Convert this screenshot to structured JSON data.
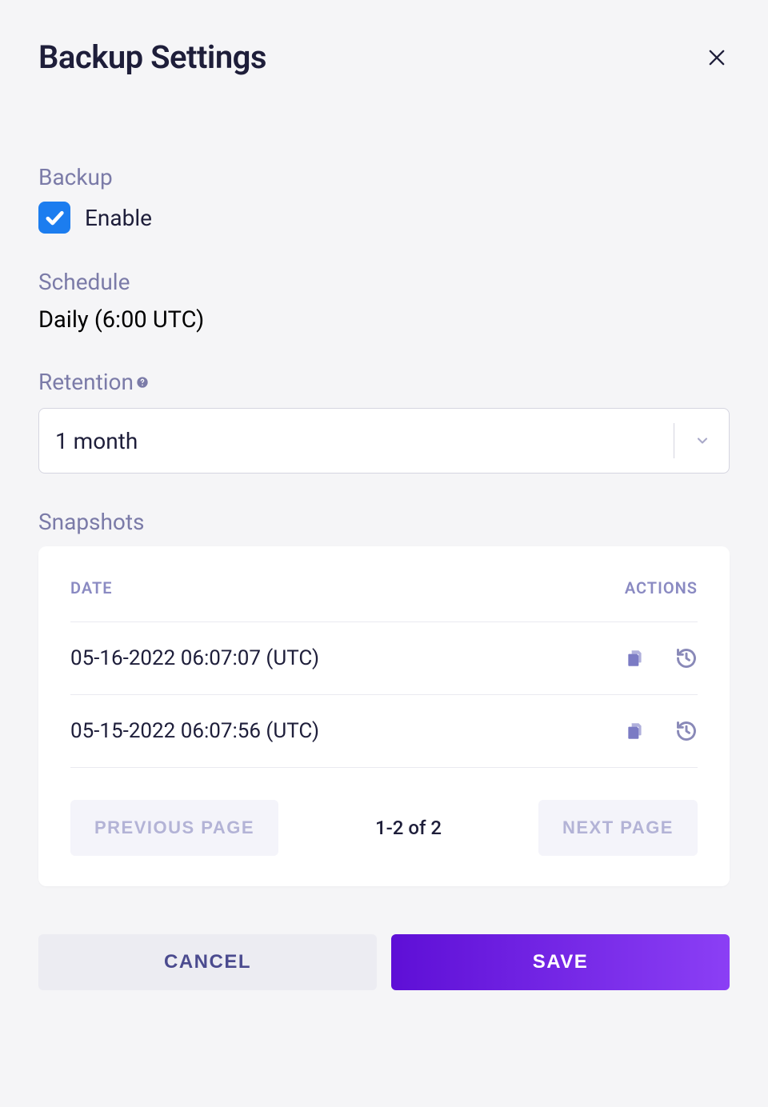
{
  "header": {
    "title": "Backup Settings"
  },
  "backup": {
    "label": "Backup",
    "enable_label": "Enable",
    "enabled": true
  },
  "schedule": {
    "label": "Schedule",
    "value": "Daily (6:00 UTC)"
  },
  "retention": {
    "label": "Retention",
    "value": "1 month"
  },
  "snapshots": {
    "label": "Snapshots",
    "columns": {
      "date": "DATE",
      "actions": "ACTIONS"
    },
    "rows": [
      {
        "date": "05-16-2022 06:07:07 (UTC)"
      },
      {
        "date": "05-15-2022 06:07:56 (UTC)"
      }
    ],
    "pagination": {
      "prev": "PREVIOUS PAGE",
      "info": "1-2 of 2",
      "next": "NEXT PAGE"
    }
  },
  "footer": {
    "cancel": "CANCEL",
    "save": "SAVE"
  }
}
